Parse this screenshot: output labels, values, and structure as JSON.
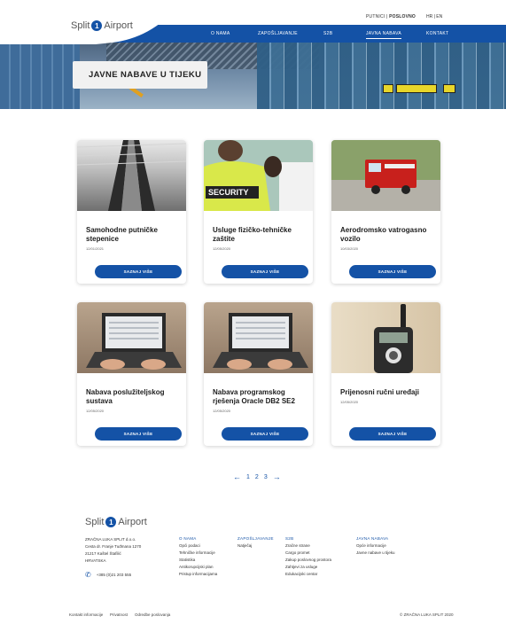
{
  "topbar": {
    "quick_normal": "PUTNICI | ",
    "quick_bold": "POSLOVNO",
    "lang": "HR | EN"
  },
  "logo": {
    "text_left": "Split",
    "text_right": "Airport"
  },
  "nav": {
    "items": [
      "O NAMA",
      "ZAPOŠLJAVANJE",
      "S2B",
      "JAVNA NABAVA",
      "KONTAKT"
    ],
    "active": "JAVNA NABAVA"
  },
  "hero": {
    "title": "JAVNE NABAVE U TIJEKU"
  },
  "cards": [
    {
      "title": "Samohodne putničke stepenice",
      "date": "12/01/2021",
      "button": "SAZNAJ VIŠE",
      "image": "escalator-photo"
    },
    {
      "title": "Usluge fizičko-tehničke zaštite",
      "date": "12/05/2020",
      "button": "SAZNAJ VIŠE",
      "image": "security-photo"
    },
    {
      "title": "Aerodromsko vatrogasno vozilo",
      "date": "10/03/2020",
      "button": "SAZNAJ VIŠE",
      "image": "fire-truck-photo"
    },
    {
      "title": "Nabava poslužiteljskog sustava",
      "date": "12/05/2020",
      "button": "SAZNAJ VIŠE",
      "image": "laptop-photo"
    },
    {
      "title": "Nabava programskog rješenja Oracle DB2 SE2",
      "date": "12/05/2020",
      "button": "SAZNAJ VIŠE",
      "image": "laptop-photo"
    },
    {
      "title": "Prijenosni ručni uređaji",
      "date": "12/05/2020",
      "button": "SAZNAJ VIŠE",
      "image": "radio-photo"
    }
  ],
  "pagination": {
    "prev": "←",
    "pages": [
      "1",
      "2",
      "3"
    ],
    "next": "→"
  },
  "footer": {
    "logo_left": "Split",
    "logo_right": "Airport",
    "address": [
      "ZRAČNA LUKA SPLIT d.o.o.",
      "Cesta dr. Franje Tuđmana 1270",
      "21217 Kaštel Štafilić",
      "HRVATSKA"
    ],
    "phone": "+385 (0)21 203 555",
    "columns": [
      {
        "heading": "O NAMA",
        "links": [
          "Opći podaci",
          "Tehničke informacije",
          "Statistika",
          "Antikorupcijski plan",
          "Pristup informacijama"
        ]
      },
      {
        "heading": "ZAPOŠLJAVANJE",
        "links": [
          "Natječaj"
        ]
      },
      {
        "heading": "S2B",
        "links": [
          "Zračne strane",
          "Cargo promet",
          "Zakup poslovnog prostora",
          "Zahtjevi za usluge",
          "Edukacijski centar"
        ]
      },
      {
        "heading": "JAVNA NABAVA",
        "links": [
          "Opće informacije",
          "Javne nabave u tijeku"
        ]
      }
    ],
    "bottom_links": [
      "Kontakt informacije",
      "Privatnost",
      "Odredbe poslovanja"
    ],
    "copyright": "© ZRAČNA LUKA SPLIT 2020"
  },
  "colors": {
    "brand_blue": "#1452a6"
  }
}
